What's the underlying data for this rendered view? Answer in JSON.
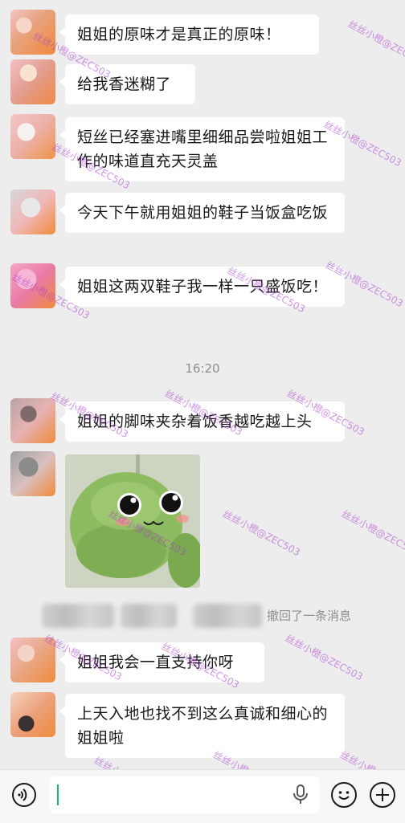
{
  "messages": [
    {
      "text": "姐姐的原味才是真正的原味！"
    },
    {
      "text": "给我香迷糊了"
    },
    {
      "text": "短丝已经塞进嘴里细细品尝啦姐姐工作的味道直充天灵盖"
    },
    {
      "text": "今天下午就用姐姐的鞋子当饭盒吃饭"
    },
    {
      "text": "姐姐这两双鞋子我一样一只盛饭吃！"
    },
    {
      "text": "姐姐的脚味夹杂着饭香越吃越上头"
    },
    {
      "text": "姐姐我会一直支持你呀"
    },
    {
      "text": "上天入地也找不到这么真诚和细心的姐姐啦"
    }
  ],
  "timestamp": "16:20",
  "recall_notice": "撤回了一条消息",
  "watermark": "丝丝小橙@ZEC503",
  "input": {
    "value": ""
  },
  "icons": {
    "voice": "voice-icon",
    "mic": "microphone-icon",
    "emoji": "emoji-icon",
    "plus": "plus-icon"
  },
  "colors": {
    "background": "#ededed",
    "bubble": "#ffffff",
    "cursor": "#07c160"
  }
}
